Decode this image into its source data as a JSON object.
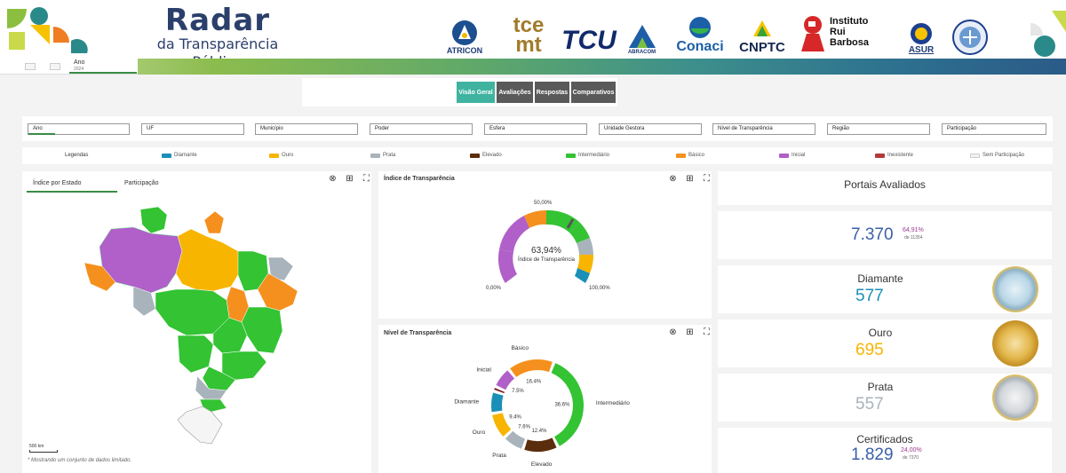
{
  "header": {
    "title": "Radar",
    "subtitle": "da Transparência Pública",
    "logos": [
      {
        "name": "atricon",
        "label": "ATRICON"
      },
      {
        "name": "tce-mt",
        "label": "tce mt"
      },
      {
        "name": "tcu",
        "label": "TCU"
      },
      {
        "name": "abracom",
        "label": "ABRACOM"
      },
      {
        "name": "conaci",
        "label": "Conaci"
      },
      {
        "name": "cnptc",
        "label": "CNPTC"
      },
      {
        "name": "instituto-rui-barbosa",
        "label": "Instituto Rui Barbosa"
      },
      {
        "name": "asur",
        "label": "ASUR"
      },
      {
        "name": "audicon",
        "label": ""
      }
    ]
  },
  "year_tab": {
    "label": "Ano",
    "value": "2024"
  },
  "nav": {
    "tabs": [
      "Visão Geral",
      "Avaliações",
      "Respostas",
      "Comparativos"
    ],
    "active": "Visão Geral"
  },
  "filters": [
    "Ano",
    "UF",
    "Município",
    "Poder",
    "Esfera",
    "Unidade Gestora",
    "Nível de Transparência",
    "Região",
    "Participação"
  ],
  "legend": {
    "title": "Legendas",
    "items": [
      {
        "label": "Diamante",
        "color": "#1b8fb8"
      },
      {
        "label": "Ouro",
        "color": "#f7b500"
      },
      {
        "label": "Prata",
        "color": "#a9b3bb"
      },
      {
        "label": "Elevado",
        "color": "#5a2d0c"
      },
      {
        "label": "Intermediário",
        "color": "#33c333"
      },
      {
        "label": "Básico",
        "color": "#f5901e"
      },
      {
        "label": "Inicial",
        "color": "#b060c8"
      },
      {
        "label": "Inexistente",
        "color": "#b33a3a"
      },
      {
        "label": "Sem Participação",
        "color": "#f2f2f2"
      }
    ]
  },
  "map_panel": {
    "tabs": [
      "Índice por Estado",
      "Participação"
    ],
    "active_tab": "Índice por Estado",
    "scale_label": "500 km",
    "note": "* Mostrando um conjunto de dados limitado."
  },
  "gauge_panel": {
    "title": "Índice de Transparência",
    "value_label": "63,94%",
    "caption": "Índice de Transparência",
    "min_label": "0,00%",
    "mid_label": "50,00%",
    "max_label": "100,00%",
    "value": 63.94
  },
  "donut_panel": {
    "title": "Nível de Transparência"
  },
  "chart_data": {
    "type": "pie",
    "title": "Nível de Transparência",
    "categories": [
      "Diamante",
      "Inexistente",
      "Inicial",
      "Básico",
      "Intermediário",
      "Elevado",
      "Prata",
      "Ouro"
    ],
    "values": [
      7.8,
      1.7,
      7.5,
      16.4,
      36.6,
      12.4,
      7.6,
      9.4
    ],
    "colors": [
      "#1b8fb8",
      "#7a1c1c",
      "#b060c8",
      "#f5901e",
      "#33c333",
      "#5a2d0c",
      "#a9b3bb",
      "#f7b500"
    ],
    "labels": {
      "Inicial": "7.5%",
      "Básico": "16.4%",
      "Intermediário": "36.6%",
      "Elevado": "12.4%",
      "Prata": "7.6%",
      "Ouro": "9.4%"
    }
  },
  "cards": {
    "portais": {
      "title": "Portais Avaliados",
      "value": "7.370",
      "pct": "64,91%",
      "sub": "de 11354"
    },
    "diamante": {
      "title": "Diamante",
      "value": "577",
      "color": "#1b8fb8"
    },
    "ouro": {
      "title": "Ouro",
      "value": "695",
      "color": "#f7b500"
    },
    "prata": {
      "title": "Prata",
      "value": "557",
      "color": "#a9b3bb"
    },
    "certificados": {
      "title": "Certificados",
      "value": "1.829",
      "pct": "24,00%",
      "sub": "de 7370"
    }
  }
}
